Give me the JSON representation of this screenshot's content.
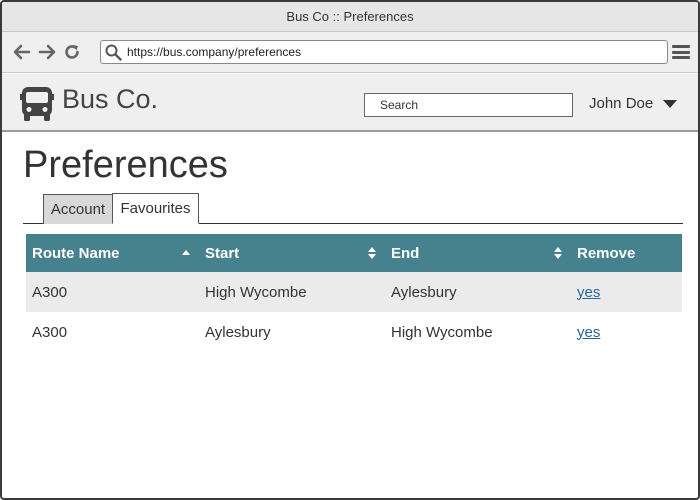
{
  "window": {
    "title": "Bus Co :: Preferences"
  },
  "browser": {
    "url": "https://bus.company/preferences"
  },
  "header": {
    "brand": "Bus Co.",
    "search_placeholder": "Search",
    "user_name": "John Doe"
  },
  "page": {
    "title": "Preferences",
    "tabs": [
      {
        "label": "Account",
        "active": false
      },
      {
        "label": "Favourites",
        "active": true
      }
    ]
  },
  "table": {
    "columns": [
      {
        "label": "Route Name",
        "sort": "ascending"
      },
      {
        "label": "Start",
        "sort": "sortable"
      },
      {
        "label": "End",
        "sort": "sortable"
      },
      {
        "label": "Remove",
        "sort": "none"
      }
    ],
    "rows": [
      {
        "route": "A300",
        "start": "High Wycombe",
        "end": "Aylesbury",
        "remove": "yes"
      },
      {
        "route": "A300",
        "start": "Aylesbury",
        "end": "High Wycombe",
        "remove": "yes"
      }
    ]
  },
  "colors": {
    "table_header": "#46818e",
    "link": "#2a64a0"
  },
  "icons": [
    "back-arrow-icon",
    "forward-arrow-icon",
    "reload-icon",
    "search-icon",
    "hamburger-menu-icon",
    "bus-icon",
    "caret-down-icon",
    "sort-asc-icon",
    "sort-both-icon"
  ]
}
